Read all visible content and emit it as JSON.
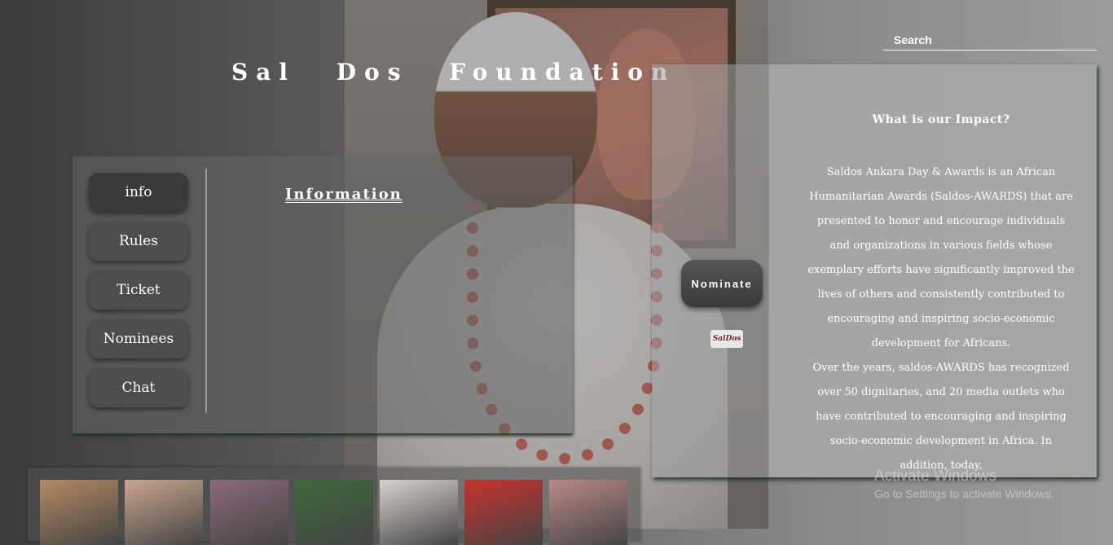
{
  "header": {
    "title": "Sal Dos Foundation"
  },
  "search": {
    "placeholder": "Search"
  },
  "menu": {
    "items": [
      {
        "label": "info",
        "active": true
      },
      {
        "label": "Rules"
      },
      {
        "label": "Ticket"
      },
      {
        "label": "Nominees"
      },
      {
        "label": "Chat"
      }
    ]
  },
  "content": {
    "heading": "Information"
  },
  "nominate": {
    "label": "Nominate"
  },
  "logo": {
    "text": "SalDos"
  },
  "impact": {
    "heading": "What is our Impact?",
    "paragraph1": "Saldos Ankara Day & Awards is an African Humanitarian Awards (Saldos-AWARDS) that are presented to honor and encourage individuals and organizations in various fields whose exemplary efforts have significantly improved the lives of others and consistently contributed to encouraging and inspiring socio-economic development for Africans.",
    "paragraph2": "Over the years, saldos-AWARDS has recognized over 50 dignitaries, and 20 media outlets who have contributed to encouraging and inspiring socio-economic development in Africa. In addition, today,"
  },
  "watermark": {
    "line1": "Activate Windows",
    "line2": "Go to Settings to activate Windows."
  },
  "gallery": {
    "thumb_colors": [
      "#b58a63",
      "#c9a68e",
      "#8c6a7a",
      "#3d6a3a",
      "#d8d2cf",
      "#c8322c",
      "#b98a86"
    ]
  }
}
